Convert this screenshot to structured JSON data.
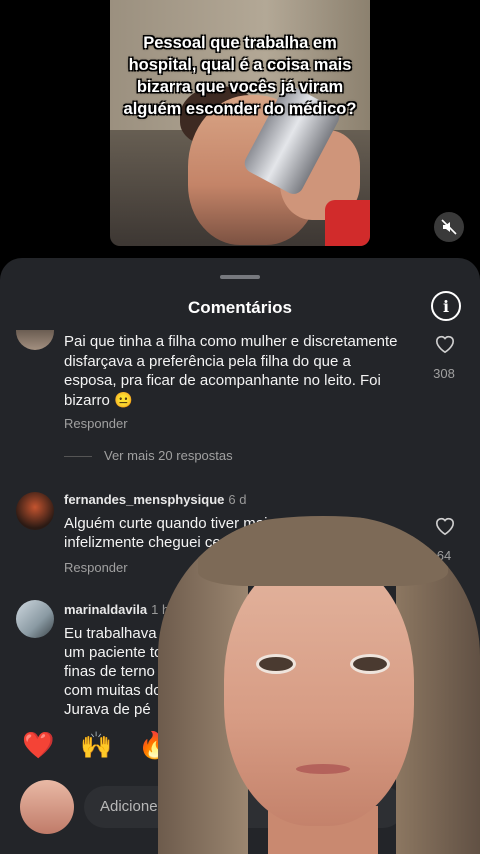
{
  "video": {
    "caption": "Pessoal que trabalha em hospital, qual é a coisa mais bizarra que vocês já viram alguém esconder do médico?"
  },
  "sheet": {
    "title": "Comentários"
  },
  "comments": [
    {
      "text": "Pai que tinha a filha como mulher e discretamente disfarçava a preferência pela filha do que a esposa, pra ficar de acompanhante no leito. Foi bizarro 😐",
      "reply_label": "Responder",
      "likes": "308",
      "more_replies": "Ver mais 20 respostas"
    },
    {
      "username": "fernandes_mensphysique",
      "time": "6 d",
      "text_line1": "Alguém curte quando tiver mai",
      "text_line2": "infelizmente cheguei ced",
      "reply_label": "Responder",
      "likes": "64"
    },
    {
      "username": "marinaldavila",
      "time": "1 h",
      "lines": [
        "Eu trabalhava num",
        "um paciente todo",
        "finas de terno e",
        "com muitas do",
        "Jurava de pé"
      ]
    }
  ],
  "emojis": [
    "❤️",
    "🙌",
    "🔥"
  ],
  "input": {
    "placeholder": "Adicione"
  }
}
